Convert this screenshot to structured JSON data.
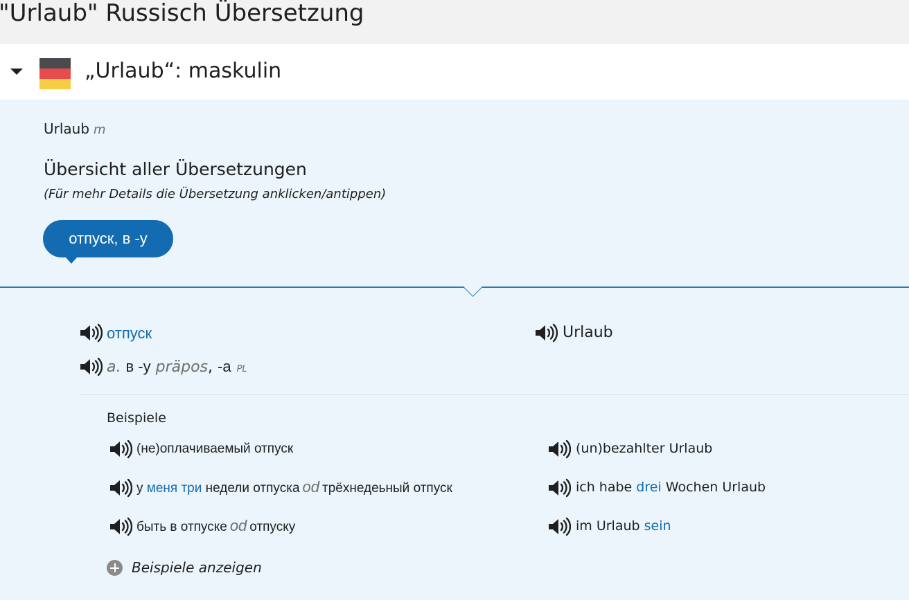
{
  "page": {
    "title": "\"Urlaub\" Russisch Übersetzung"
  },
  "entry": {
    "title": "„Urlaub“: maskulin",
    "flag_icon": "german-flag-icon",
    "headword": "Urlaub",
    "headword_gender": "m",
    "overview_title": "Übersicht aller Übersetzungen",
    "overview_hint": "(Für mehr Details die Übersetzung anklicken/antippen)",
    "translation_pill": "отпуск, в -у"
  },
  "translation": {
    "ru_word": "отпуск",
    "de_word": "Urlaub",
    "grammar": {
      "prefix": "a.",
      "form1": "в -у",
      "case": "präpos",
      "comma": ",",
      "form2": "-а",
      "number": "PL"
    }
  },
  "examples": {
    "label": "Beispiele",
    "rows": [
      {
        "ru": [
          "(не)оплачиваемый отпуск"
        ],
        "de": [
          "(un)bezahlter Urlaub"
        ]
      },
      {
        "ru": [
          "у",
          "меня три",
          "недели отпуска",
          "od",
          "трёхнедеьный отпуск"
        ],
        "de": [
          "ich habe",
          "drei",
          "Wochen Urlaub"
        ]
      },
      {
        "ru": [
          "быть в отпуске",
          "od",
          "отпуску"
        ],
        "de": [
          "im Urlaub",
          "sein"
        ]
      }
    ],
    "show_more": "Beispiele anzeigen"
  },
  "colors": {
    "accent": "#136cb2",
    "panel_bg": "#ebf5fb",
    "header_bg": "#f2f2f2"
  }
}
